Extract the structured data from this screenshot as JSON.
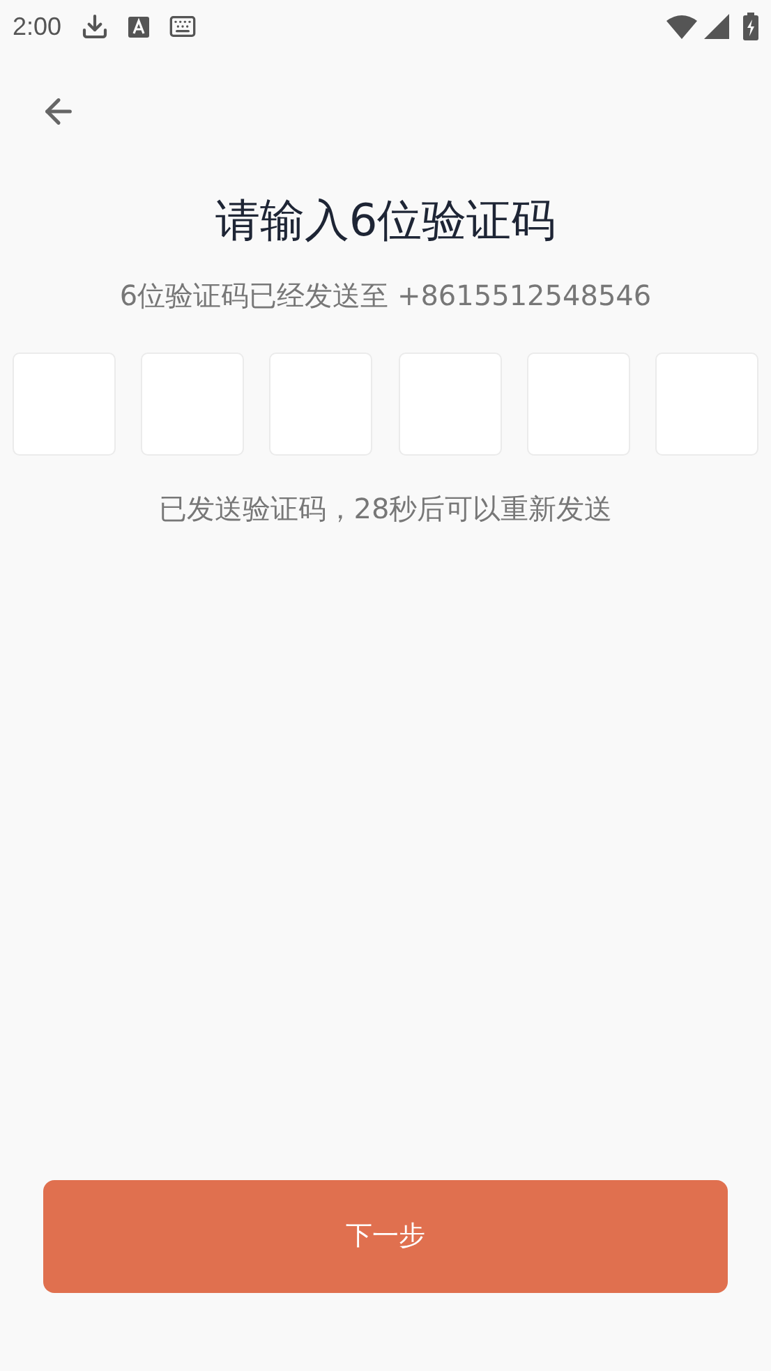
{
  "status_bar": {
    "time": "2:00"
  },
  "title": "请输入6位验证码",
  "subtitle": "6位验证码已经发送至 +8615512548546",
  "code_fields": [
    {
      "kind": "digit"
    },
    {
      "kind": "digit"
    },
    {
      "kind": "digit"
    },
    {
      "kind": "digit"
    },
    {
      "kind": "digit"
    },
    {
      "kind": "digit"
    }
  ],
  "resend_hint": "已发送验证码，28秒后可以重新发送",
  "next_button": "下一步"
}
